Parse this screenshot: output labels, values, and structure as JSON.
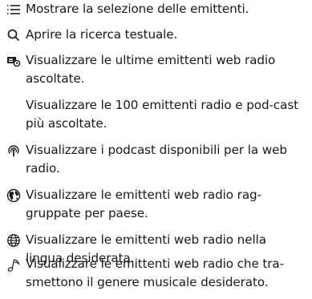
{
  "items": [
    {
      "icon": "list-icon",
      "text": "Mostrare la selezione delle emittenti."
    },
    {
      "icon": "search-icon",
      "text": "Aprire la ricerca testuale."
    },
    {
      "icon": "recent-radio-icon",
      "text": "Visualizzare le ultime emittenti web radio ascoltate."
    },
    {
      "icon": "top-100-icon",
      "text": "Visualizzare le 100 emittenti radio e pod-cast più ascoltate."
    },
    {
      "icon": "podcast-icon",
      "text": "Visualizzare i podcast disponibili per la web radio."
    },
    {
      "icon": "globe-country-icon",
      "text": "Visualizzare le emittenti web radio rag-gruppate per paese."
    },
    {
      "icon": "language-globe-icon",
      "text": "Visualizzare le emittenti web radio nella lingua desiderata."
    },
    {
      "icon": "music-note-icon",
      "text": "Visualizzare le emittenti web radio che tra-smettono il genere musicale desiderato."
    }
  ]
}
